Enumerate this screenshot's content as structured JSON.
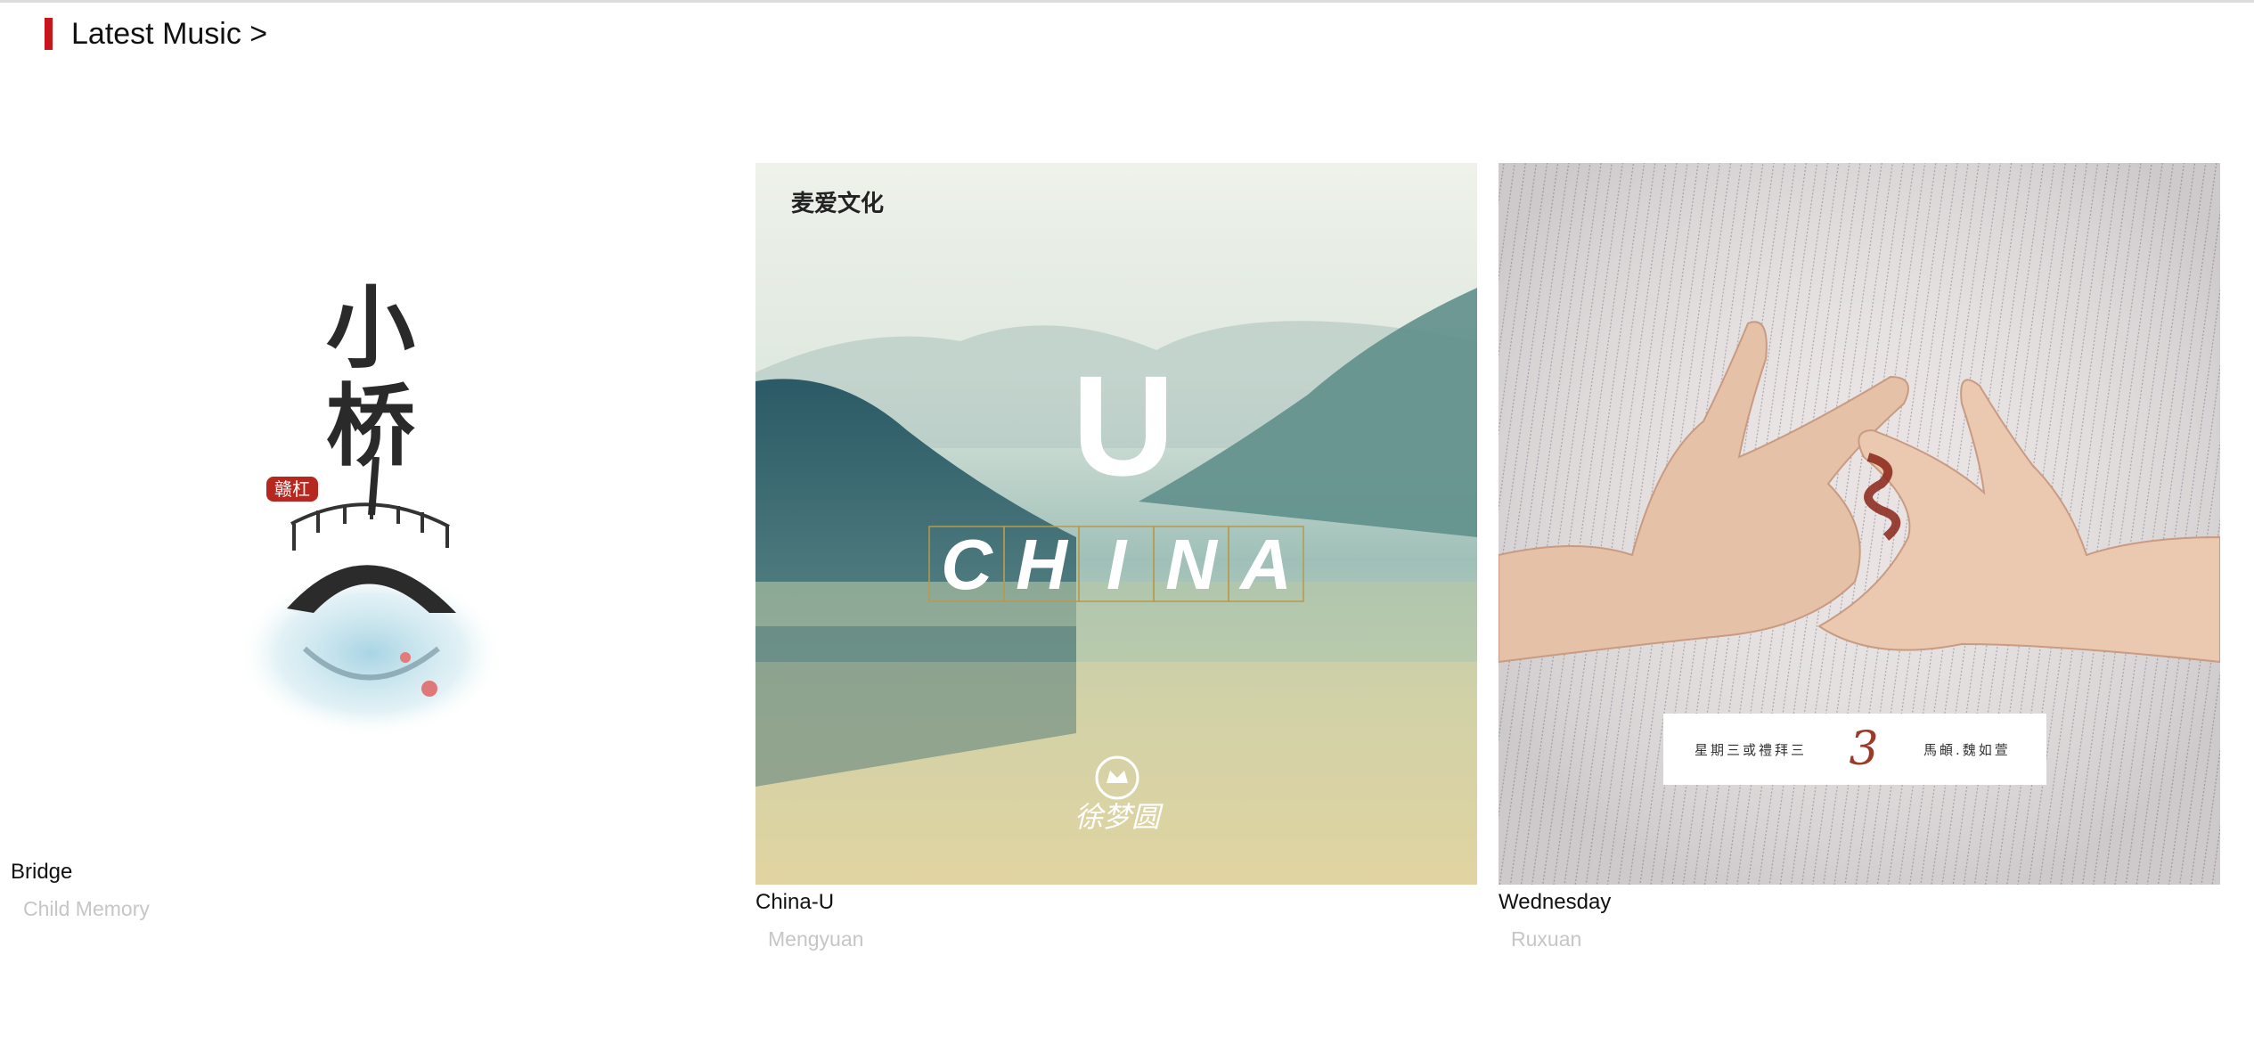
{
  "section": {
    "title": "Latest Music >"
  },
  "songs": [
    {
      "title": "Bridge",
      "artist": "Child Memory",
      "cover": {
        "calligraphy_top": "小",
        "calligraphy_bottom": "桥",
        "seal_text": "赣杠"
      }
    },
    {
      "title": "China-U",
      "artist": "Mengyuan",
      "cover": {
        "label_brand": "麦爱文化",
        "big_letter": "U",
        "word_letters": [
          "C",
          "H",
          "I",
          "N",
          "A"
        ],
        "signature": "徐梦圆"
      }
    },
    {
      "title": "Wednesday",
      "artist": "Ruxuan",
      "cover": {
        "left_text": "星期三或禮拜三",
        "number": "3",
        "right_text": "馬頔.魏如萱"
      }
    }
  ],
  "colors": {
    "accent": "#c8161d",
    "title": "#111111",
    "artist": "#c6c6c6"
  }
}
